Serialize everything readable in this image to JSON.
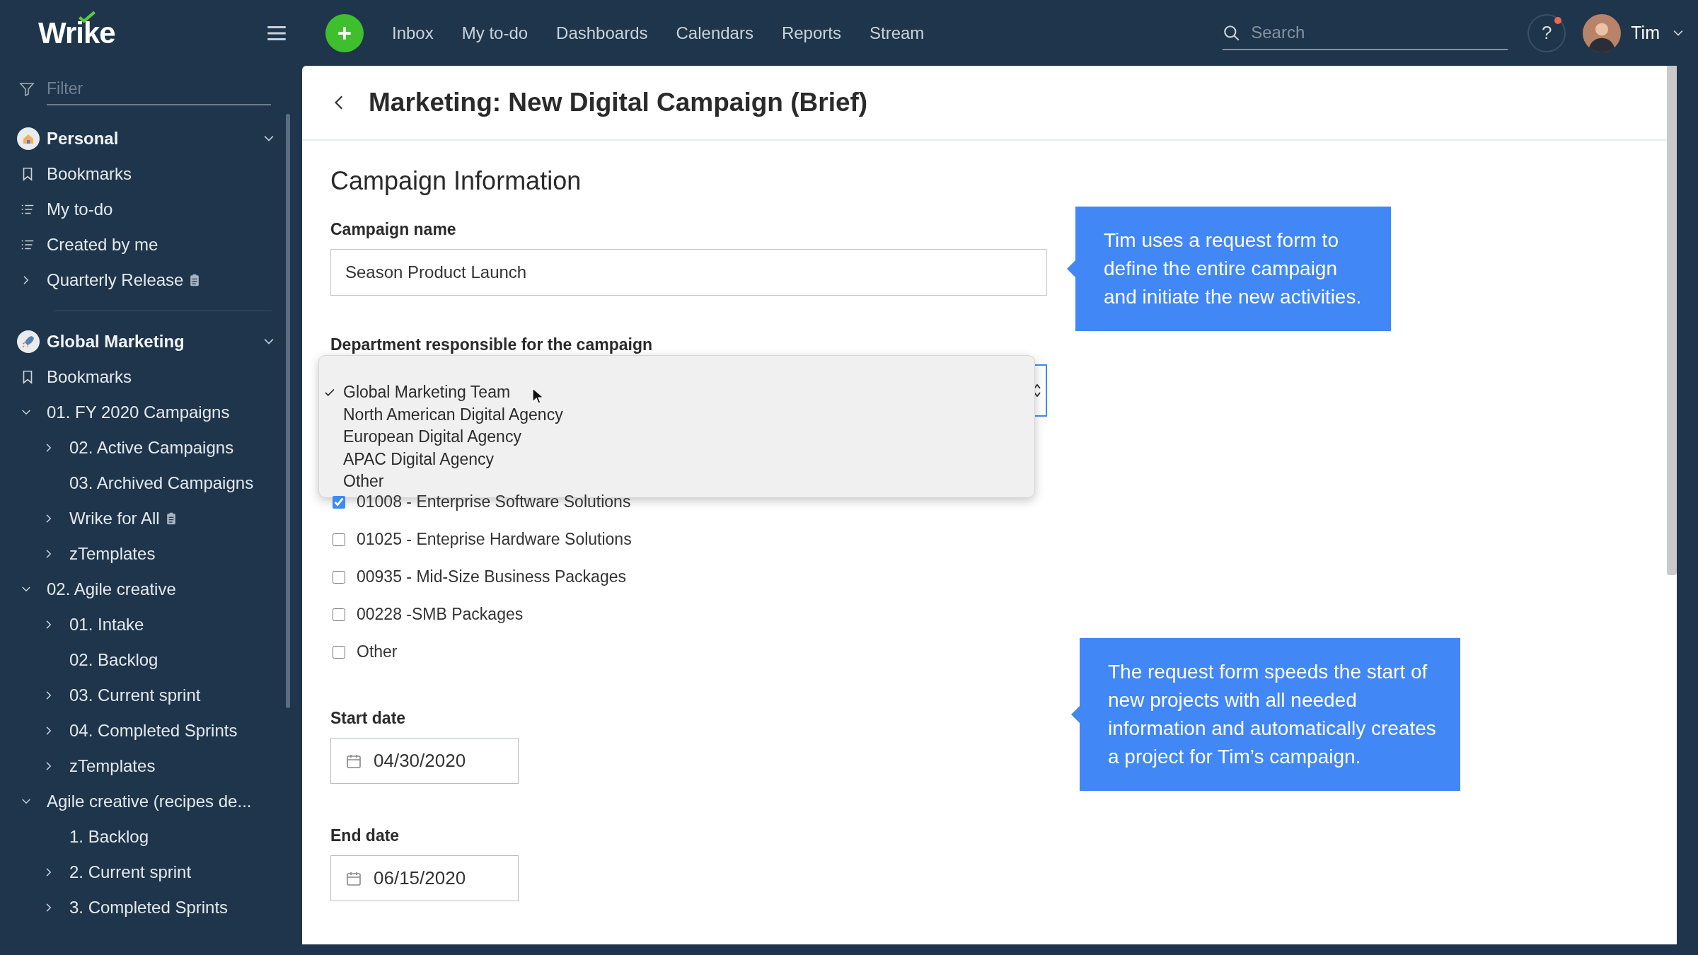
{
  "topbar": {
    "logo": "Wrike",
    "nav": [
      {
        "label": "Inbox"
      },
      {
        "label": "My to-do"
      },
      {
        "label": "Dashboards"
      },
      {
        "label": "Calendars"
      },
      {
        "label": "Reports"
      },
      {
        "label": "Stream"
      }
    ],
    "search": {
      "placeholder": "Search"
    },
    "help": {
      "label": "?",
      "notification": true
    },
    "user": {
      "name": "Tim"
    }
  },
  "sidebar": {
    "filter": {
      "placeholder": "Filter"
    },
    "sections": [
      {
        "title": "Personal",
        "expanded": true,
        "items": [
          {
            "label": "Bookmarks",
            "kind": "bookmark",
            "form_icon": false
          },
          {
            "label": "My to-do",
            "kind": "list",
            "form_icon": false
          },
          {
            "label": "Created by me",
            "kind": "list",
            "form_icon": false
          },
          {
            "label": "Quarterly Release",
            "kind": "collapsed",
            "form_icon": true
          }
        ]
      },
      {
        "title": "Global Marketing",
        "expanded": true,
        "items": [
          {
            "label": "Bookmarks",
            "kind": "bookmark",
            "form_icon": false
          },
          {
            "label": "01. FY 2020 Campaigns",
            "kind": "expanded",
            "form_icon": false,
            "children": [
              {
                "label": "02. Active Campaigns",
                "kind": "collapsed",
                "form_icon": false
              },
              {
                "label": "03. Archived Campaigns",
                "kind": "plain",
                "form_icon": false
              },
              {
                "label": "Wrike for All",
                "kind": "collapsed",
                "form_icon": true
              },
              {
                "label": "zTemplates",
                "kind": "collapsed",
                "form_icon": false
              }
            ]
          },
          {
            "label": "02. Agile creative",
            "kind": "expanded",
            "form_icon": false,
            "children": [
              {
                "label": "01. Intake",
                "kind": "collapsed",
                "form_icon": false
              },
              {
                "label": "02. Backlog",
                "kind": "plain",
                "form_icon": false
              },
              {
                "label": "03. Current sprint",
                "kind": "collapsed",
                "form_icon": false
              },
              {
                "label": "04. Completed Sprints",
                "kind": "collapsed",
                "form_icon": false
              },
              {
                "label": "zTemplates",
                "kind": "collapsed",
                "form_icon": false
              }
            ]
          },
          {
            "label": "Agile creative (recipes de...",
            "kind": "expanded",
            "form_icon": false,
            "children": [
              {
                "label": "1. Backlog",
                "kind": "plain",
                "form_icon": false
              },
              {
                "label": "2. Current sprint",
                "kind": "collapsed",
                "form_icon": false
              },
              {
                "label": "3. Completed Sprints",
                "kind": "collapsed",
                "form_icon": false
              }
            ]
          }
        ]
      }
    ]
  },
  "page": {
    "title": "Marketing: New Digital Campaign (Brief)",
    "section_title": "Campaign Information",
    "fields": [
      {
        "kind": "text",
        "label": "Campaign name",
        "value": "Season Product Launch"
      },
      {
        "kind": "select",
        "label": "Department responsible for the campaign",
        "open": true,
        "options": [
          {
            "label": "Global Marketing Team",
            "selected": true
          },
          {
            "label": "North American Digital Agency",
            "selected": false
          },
          {
            "label": "European Digital Agency",
            "selected": false
          },
          {
            "label": "APAC Digital Agency",
            "selected": false
          },
          {
            "label": "Other",
            "selected": false
          }
        ]
      },
      {
        "kind": "checkboxes",
        "options": [
          {
            "label": "01008 - Enterprise Software Solutions",
            "checked": true
          },
          {
            "label": "01025 - Enteprise Hardware Solutions",
            "checked": false
          },
          {
            "label": "00935 - Mid-Size Business Packages",
            "checked": false
          },
          {
            "label": "00228 -SMB Packages",
            "checked": false
          },
          {
            "label": "Other",
            "checked": false
          }
        ]
      },
      {
        "kind": "date",
        "label": "Start date",
        "value": "04/30/2020"
      },
      {
        "kind": "date",
        "label": "End date",
        "value": "06/15/2020"
      }
    ]
  },
  "callouts": [
    {
      "text": "Tim uses a request form to define the entire campaign and initiate the new activities."
    },
    {
      "text": "The request form speeds the start of new projects with all needed information and automatically creates a project for Tim’s campaign."
    }
  ]
}
